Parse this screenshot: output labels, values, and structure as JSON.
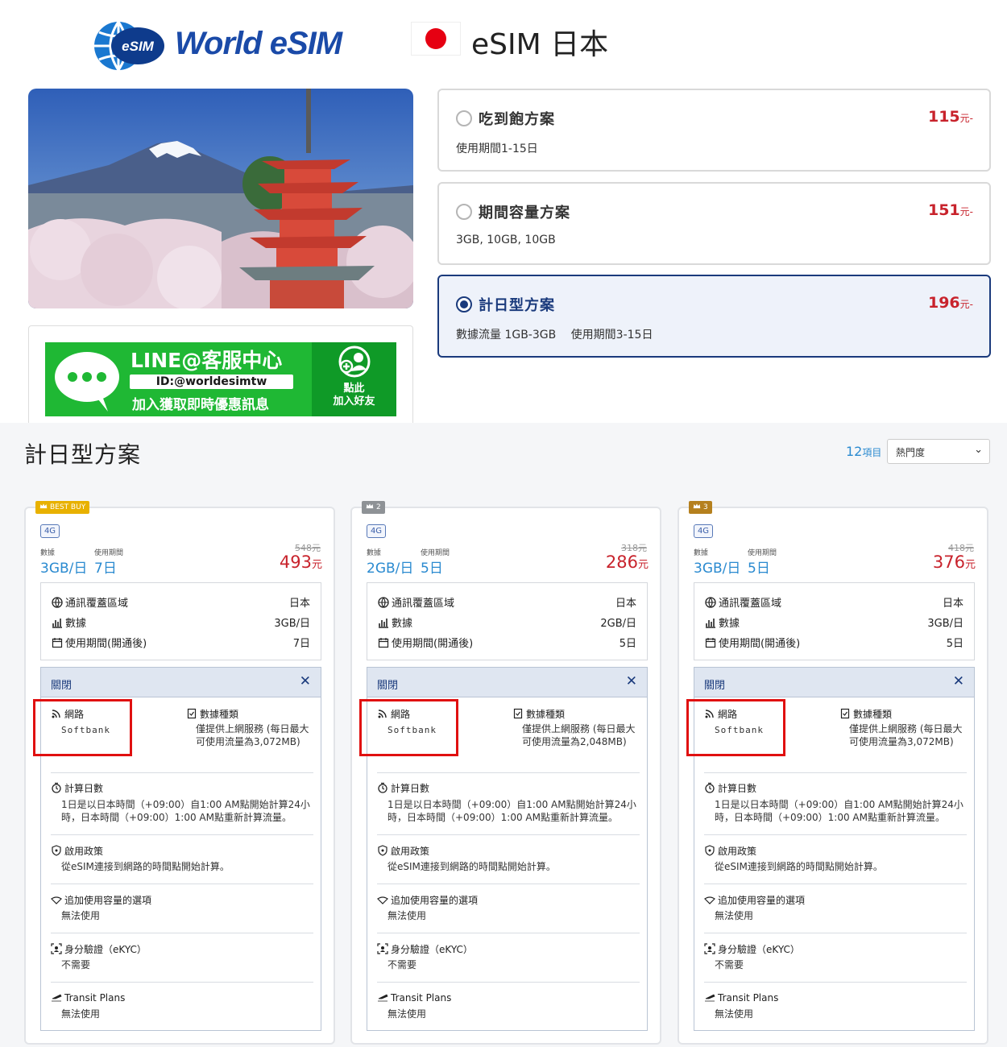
{
  "brand": {
    "logo_text": "World eSIM",
    "globe_text": "eSIM"
  },
  "page_title": "eSIM 日本",
  "line_banner": {
    "title": "LINE@客服中心",
    "id": "ID:@worldesimtw",
    "subtitle": "加入獲取即時優惠訊息",
    "cta": "點此\n加入好友"
  },
  "plan_options": [
    {
      "name": "吃到飽方案",
      "price": "115",
      "unit": "元-",
      "desc": "使用期間1-15日",
      "selected": false
    },
    {
      "name": "期間容量方案",
      "price": "151",
      "unit": "元-",
      "desc": "3GB, 10GB, 10GB",
      "selected": false
    },
    {
      "name": "計日型方案",
      "price": "196",
      "unit": "元-",
      "desc": "數據流量 1GB-3GB　 使用期間3-15日",
      "selected": true
    }
  ],
  "section": {
    "title": "計日型方案",
    "count": "12",
    "count_unit": "項目",
    "sort": "熱門度"
  },
  "labels": {
    "network_type": "4G",
    "data": "數據",
    "period": "使用期間",
    "coverage": "通訊覆蓋區域",
    "data_row": "數據",
    "period_row": "使用期間(開通後)",
    "close": "關閉",
    "network": "網路",
    "data_type": "數據種類",
    "day_count": "計算日數",
    "day_count_text": "1日是以日本時間（+09:00）自1:00 AM點開始計算24小時，日本時間（+09:00）1:00 AM點重新計算流量。",
    "activation": "啟用政策",
    "activation_text": "從eSIM連接到網路的時間點開始計算。",
    "topup": "追加使用容量的選項",
    "topup_text": "無法使用",
    "ekyc": "身分驗證（eKYC）",
    "ekyc_text": "不需要",
    "transit": "Transit Plans",
    "transit_text": "無法使用",
    "yuan": "元"
  },
  "colors": {
    "accent": "#2a8ad0",
    "price": "#c8232c",
    "navy": "#1a3a7c",
    "highlight": "#e01010",
    "line_green": "#1fb834"
  },
  "cards": [
    {
      "rank": "BEST BUY",
      "rank_color": "#e8b100",
      "data": "3GB/日",
      "days": "7日",
      "old_price": "548元",
      "price": "493",
      "coverage": "日本",
      "data_row": "3GB/日",
      "period_row": "7日",
      "carrier": "Softbank",
      "data_type_text": "僅提供上網服務 (每日最大可使用流量為3,072MB)"
    },
    {
      "rank": "2",
      "rank_color": "#8e9296",
      "data": "2GB/日",
      "days": "5日",
      "old_price": "318元",
      "price": "286",
      "coverage": "日本",
      "data_row": "2GB/日",
      "period_row": "5日",
      "carrier": "Softbank",
      "data_type_text": "僅提供上網服務 (每日最大可使用流量為2,048MB)"
    },
    {
      "rank": "3",
      "rank_color": "#b5801e",
      "data": "3GB/日",
      "days": "5日",
      "old_price": "418元",
      "price": "376",
      "coverage": "日本",
      "data_row": "3GB/日",
      "period_row": "5日",
      "carrier": "Softbank",
      "data_type_text": "僅提供上網服務 (每日最大可使用流量為3,072MB)"
    }
  ]
}
